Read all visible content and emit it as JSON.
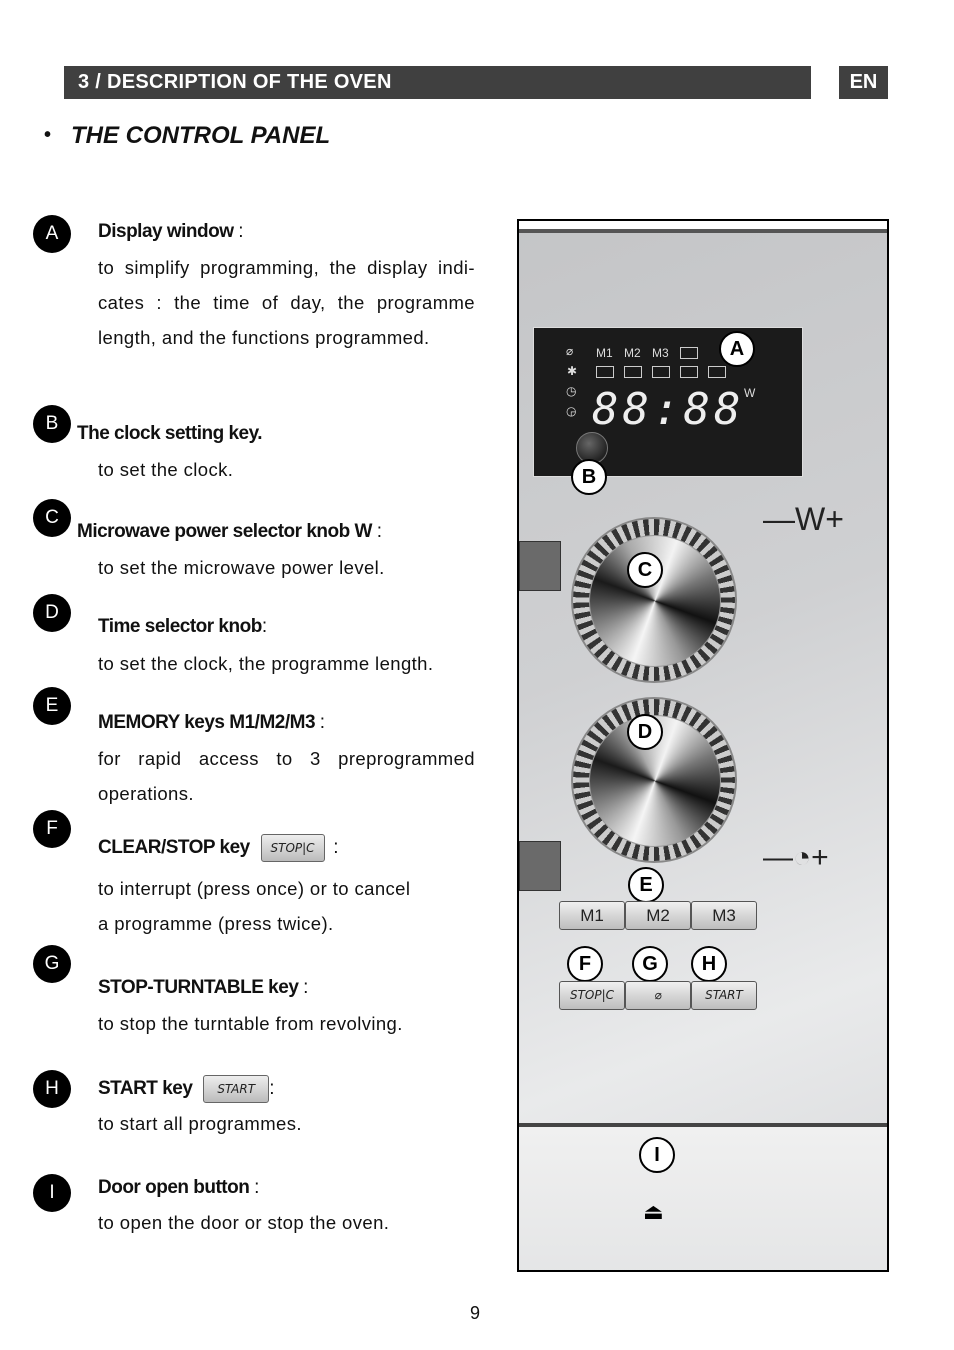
{
  "header": {
    "section_title": "3 / DESCRIPTION OF THE OVEN",
    "language": "EN"
  },
  "heading": {
    "bullet": "•",
    "title": "THE CONTROL PANEL"
  },
  "items": [
    {
      "badge": "A",
      "title": "Display window",
      "suffix": " :",
      "desc": "to simplify programming, the display indi- cates : the time of day, the programme length, and the functions programmed."
    },
    {
      "badge": "B",
      "title": "The clock setting key.",
      "suffix": "",
      "desc": "to set the clock."
    },
    {
      "badge": "C",
      "title": "Microwave power selector knob W",
      "suffix": " :",
      "desc": "to set the microwave power level."
    },
    {
      "badge": "D",
      "title": "Time selector knob",
      "suffix": ":",
      "desc": "to set the clock, the programme length."
    },
    {
      "badge": "E",
      "title": "MEMORY keys M1/M2/M3",
      "suffix": " :",
      "desc": "for rapid access to 3 preprogrammed operations."
    },
    {
      "badge": "F",
      "title": "CLEAR/STOP key",
      "suffix": " :",
      "key_label": "STOP|C",
      "desc_lines": [
        "to interrupt (press once) or to cancel",
        "a programme (press twice)."
      ]
    },
    {
      "badge": "G",
      "title": "STOP-TURNTABLE key",
      "suffix": " :",
      "desc": "to stop the turntable from revolving."
    },
    {
      "badge": "H",
      "title": "START key",
      "suffix": ":",
      "key_label": "START",
      "desc": "to start all programmes."
    },
    {
      "badge": "I",
      "title": "Door open button",
      "suffix": " :",
      "desc": "to open the door or stop the oven."
    }
  ],
  "panel": {
    "display": {
      "memory_labels": [
        "M1",
        "M2",
        "M3"
      ],
      "digits": "88:88",
      "unit": "W",
      "turntable_icon": "⌀",
      "defrost_icon": "✱",
      "clock_icon_1": "◷",
      "clock_icon_2": "◶"
    },
    "callouts": [
      "A",
      "B",
      "C",
      "D",
      "E",
      "F",
      "G",
      "H",
      "I"
    ],
    "power_label": "—W+",
    "time_label": "—◔+",
    "memory_keys": [
      "M1",
      "M2",
      "M3"
    ],
    "function_keys": [
      "STOP|C",
      "⌀",
      "START"
    ],
    "eject_icon": "⏏"
  },
  "page_number": "9"
}
